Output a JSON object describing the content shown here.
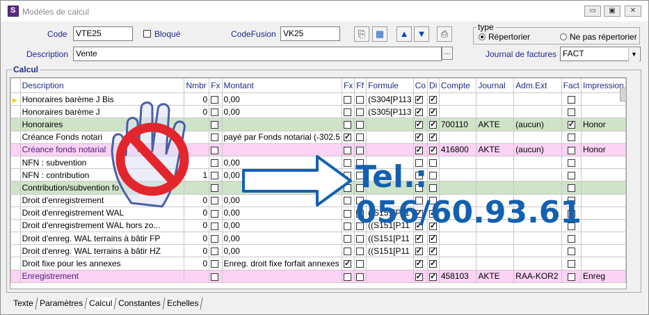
{
  "window": {
    "title": "Modèles de calcul",
    "minimize": "▭",
    "restore": "▣",
    "close": "✕"
  },
  "form": {
    "code_label": "Code",
    "code_value": "VTE25",
    "bloque_label": "Bloqué",
    "codefusion_label": "CodeFusion",
    "codefusion_value": "VK25",
    "description_label": "Description",
    "description_value": "Vente",
    "journal_label": "Journal de factures",
    "journal_value": "FACT",
    "type_label": "type",
    "radio_repertoire": "Répertorier",
    "radio_non": "Ne pas répertorier",
    "ellipsis": "…"
  },
  "toolbar": {
    "up_icon": "▲",
    "down_icon": "▼"
  },
  "calcul_label": "Calcul",
  "columns": [
    "Description",
    "Nmbr",
    "Fx",
    "Montant",
    "Fx",
    "Ff",
    "Formule",
    "Co",
    "Di",
    "Compte",
    "Journal",
    "Adm.Ext",
    "Fact",
    "Impression"
  ],
  "rows": [
    {
      "desc": "Honoraires barème J Bis",
      "nmbr": "0",
      "fx": false,
      "montant": "0,00",
      "fx2": false,
      "ff": false,
      "formule": "(S304[P113",
      "co": true,
      "di": true,
      "compte": "",
      "journal": "",
      "adm": "",
      "fact": false,
      "impr": "",
      "style": "",
      "marker": true
    },
    {
      "desc": "Honoraires barème J",
      "nmbr": "0",
      "fx": false,
      "montant": "0,00",
      "fx2": false,
      "ff": false,
      "formule": "(S305[P113",
      "co": true,
      "di": true,
      "compte": "",
      "journal": "",
      "adm": "",
      "fact": false,
      "impr": "",
      "style": ""
    },
    {
      "desc": "Honoraires",
      "nmbr": "",
      "fx": false,
      "montant": "",
      "fx2": false,
      "ff": false,
      "formule": "",
      "co": true,
      "di": true,
      "compte": "700110",
      "journal": "AKTE",
      "adm": "(aucun)",
      "fact": true,
      "impr": "Honor",
      "style": "green"
    },
    {
      "desc": "Créance Fonds notari",
      "nmbr": "",
      "fx": false,
      "montant": "payé par Fonds notarial (-302.5",
      "fx2": true,
      "ff": false,
      "formule": "",
      "co": true,
      "di": true,
      "compte": "",
      "journal": "",
      "adm": "",
      "fact": false,
      "impr": "",
      "style": ""
    },
    {
      "desc": "Créance fonds notarial",
      "nmbr": "",
      "fx": false,
      "montant": "",
      "fx2": false,
      "ff": false,
      "formule": "",
      "co": true,
      "di": true,
      "compte": "416800",
      "journal": "AKTE",
      "adm": "(aucun)",
      "fact": false,
      "impr": "Honor",
      "style": "pink"
    },
    {
      "desc": "NFN : subvention",
      "nmbr": "",
      "fx": false,
      "montant": "0,00",
      "fx2": false,
      "ff": false,
      "formule": "",
      "co": false,
      "di": false,
      "compte": "",
      "journal": "",
      "adm": "",
      "fact": false,
      "impr": "",
      "style": ""
    },
    {
      "desc": "NFN : contribution",
      "nmbr": "1",
      "fx": false,
      "montant": "0,00",
      "fx2": false,
      "ff": false,
      "formule": "",
      "co": false,
      "di": false,
      "compte": "",
      "journal": "",
      "adm": "",
      "fact": false,
      "impr": "",
      "style": ""
    },
    {
      "desc": "Contribution/subvention fo",
      "nmbr": "",
      "fx": false,
      "montant": "",
      "fx2": false,
      "ff": false,
      "formule": "",
      "co": false,
      "di": false,
      "compte": "",
      "journal": "",
      "adm": "",
      "fact": false,
      "impr": "",
      "style": "green"
    },
    {
      "desc": "Droit d'enregistrement",
      "nmbr": "0",
      "fx": false,
      "montant": "0,00",
      "fx2": false,
      "ff": false,
      "formule": "",
      "co": false,
      "di": false,
      "compte": "",
      "journal": "",
      "adm": "",
      "fact": false,
      "impr": "",
      "style": ""
    },
    {
      "desc": "Droit d'enregistrement WAL",
      "nmbr": "0",
      "fx": false,
      "montant": "0,00",
      "fx2": false,
      "ff": false,
      "formule": "((S151[P11",
      "co": true,
      "di": true,
      "compte": "",
      "journal": "",
      "adm": "",
      "fact": false,
      "impr": "",
      "style": ""
    },
    {
      "desc": "Droit d'enregistrement WAL hors zo...",
      "nmbr": "0",
      "fx": false,
      "montant": "0,00",
      "fx2": false,
      "ff": false,
      "formule": "((S151[P11",
      "co": true,
      "di": true,
      "compte": "",
      "journal": "",
      "adm": "",
      "fact": false,
      "impr": "",
      "style": ""
    },
    {
      "desc": "Droit d'enreg. WAL terrains à bâtir FP",
      "nmbr": "0",
      "fx": false,
      "montant": "0,00",
      "fx2": false,
      "ff": false,
      "formule": "((S151[P11",
      "co": true,
      "di": true,
      "compte": "",
      "journal": "",
      "adm": "",
      "fact": false,
      "impr": "",
      "style": ""
    },
    {
      "desc": "Droit d'enreg. WAL terrains à bâtir HZ",
      "nmbr": "0",
      "fx": false,
      "montant": "0,00",
      "fx2": false,
      "ff": false,
      "formule": "((S151[P11",
      "co": true,
      "di": true,
      "compte": "",
      "journal": "",
      "adm": "",
      "fact": false,
      "impr": "",
      "style": ""
    },
    {
      "desc": "Droit fixe pour les annexes",
      "nmbr": "0",
      "fx": false,
      "montant": "Enreg. droit fixe forfait annexes",
      "fx2": true,
      "ff": false,
      "formule": "",
      "co": true,
      "di": true,
      "compte": "",
      "journal": "",
      "adm": "",
      "fact": false,
      "impr": "",
      "style": ""
    },
    {
      "desc": "Enregistrement",
      "nmbr": "",
      "fx": false,
      "montant": "",
      "fx2": false,
      "ff": false,
      "formule": "",
      "co": true,
      "di": true,
      "compte": "458103",
      "journal": "AKTE",
      "adm": "RAA-KOR2",
      "fact": false,
      "impr": "Enreg",
      "style": "pink"
    }
  ],
  "tabs": [
    "Texte",
    "Paramètres",
    "Calcul",
    "Constantes",
    "Echelles"
  ],
  "active_tab": "Calcul",
  "overlay": {
    "phone": "Tel.: 056/60.93.61"
  },
  "colors": {
    "green_row": "#cfe3c9",
    "pink_row": "#fbd3f4",
    "label_blue": "#1d2a8c",
    "phone_blue": "#1360b0",
    "stop_red": "#e3262c"
  }
}
